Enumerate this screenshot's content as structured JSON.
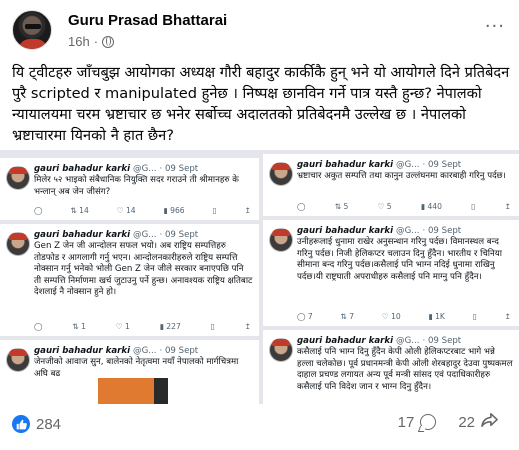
{
  "post": {
    "author": "Guru Prasad Bhattarai",
    "time": "16h",
    "more": "···",
    "text": "यि ट्वीटहरु जाँचबुझ आयोगका अध्यक्ष गौरी बहादुर कार्कीकै हुन् भने यो आयोगले दिने प्रतिबेदन पुरै scripted र manipulated हुनेछ । निष्पक्ष छानविन गर्ने पात्र यस्तै हुन्छ? नेपालको न्यायालयमा चरम भ्रष्टाचार छ भनेर सर्बोच्च अदालतको प्रतिबेदनमै उल्लेख छ । नेपालको भ्रष्टाचारमा यिनको नै हात छैन?"
  },
  "tweets": [
    {
      "name": "gauri bahadur karki",
      "handle": "@G...",
      "date": "· 09 Sept",
      "body": "मिलेर ५२ भाइको संबैधानिक नियुक्ति सदर गराउने ती श्रीमानहरु के भन्लान् अब जेन जीसंग?",
      "replies": "",
      "retweets": "14",
      "likes": "14",
      "views": "966"
    },
    {
      "name": "gauri bahadur karki",
      "handle": "@G...",
      "date": "· 09 Sept",
      "body": "Gen Z जेन जी आन्दोलन सफल भयो। अब राष्ट्रिय सम्पत्तिहरु तोडफोड र आगलागी गर्नु भएन। आन्दोलनकारीहरुले राष्ट्रिय सम्पत्ति नोक्सान गर्नु भनेको भोली Gen Z जेन जीले सरकार बनाएपछि पनि ती सम्पत्ति निर्माणमा खर्च जुटाउनु पर्ने हुन्छ। अनावश्यक राष्ट्रिय क्षतिबाट देशलाई नै नोक्सान हुने हो।",
      "replies": "",
      "retweets": "1",
      "likes": "1",
      "views": "227"
    },
    {
      "name": "gauri bahadur karki",
      "handle": "@G...",
      "date": "· 09 Sept",
      "body": "जेनजीको आवाज सुन, बालेनको नेतृत्वमा नयाँ नेपालको मार्गचित्रमा अघि बढ",
      "replies": "",
      "retweets": "",
      "likes": "",
      "views": ""
    },
    {
      "name": "gauri bahadur karki",
      "handle": "@G...",
      "date": "· 09 Sept",
      "body": "भ्रष्टाचार अकुत सम्पत्ति तथा कानुन उल्लंघनमा कारबाही गरिनु पर्दछ।",
      "replies": "",
      "retweets": "5",
      "likes": "5",
      "views": "440"
    },
    {
      "name": "gauri bahadur karki",
      "handle": "@G...",
      "date": "· 09 Sept",
      "body": "उनीहरूलाई धुनामा राखेर अनुसन्धान गरिनु पर्दछ। विमानस्थल बन्द गरिनु पर्दछ। निजी हेलिकप्टर चलाउन दिनु हुँदैन। भारतीय र चिनिया सीमाना बन्द गरिनु पर्दछ।कसैलाई पनि भाग्न नदिई धुनामा राखिनु पर्दछ।यी राष्ट्रघाती अपराधीहरु कसैलाई पनि माग्नु पनि हुँदैन।",
      "replies": "7",
      "retweets": "7",
      "likes": "10",
      "views": "1K"
    },
    {
      "name": "gauri bahadur karki",
      "handle": "@G...",
      "date": "· 09 Sept",
      "body": "कसैलाई पनि भाग्न दिनु हुँदैन केपी ओली हेलिकप्टरबाट भागे भन्ने हल्ला चलेकोछ। पूर्व प्रधानमन्त्री केपी ओली शेरबहादुर देउवा पुष्पकमल दाहाल प्रचण्ड लगायत अन्य पूर्व मन्त्री सांसद एवं पदाधिकारीहरु कसैलाई पनि विदेश जान र भाग्न दिनु हुँदैन।",
      "replies": "",
      "retweets": "",
      "likes": "",
      "views": ""
    }
  ],
  "reactions": {
    "likes": "284",
    "comments": "17",
    "shares": "22"
  }
}
